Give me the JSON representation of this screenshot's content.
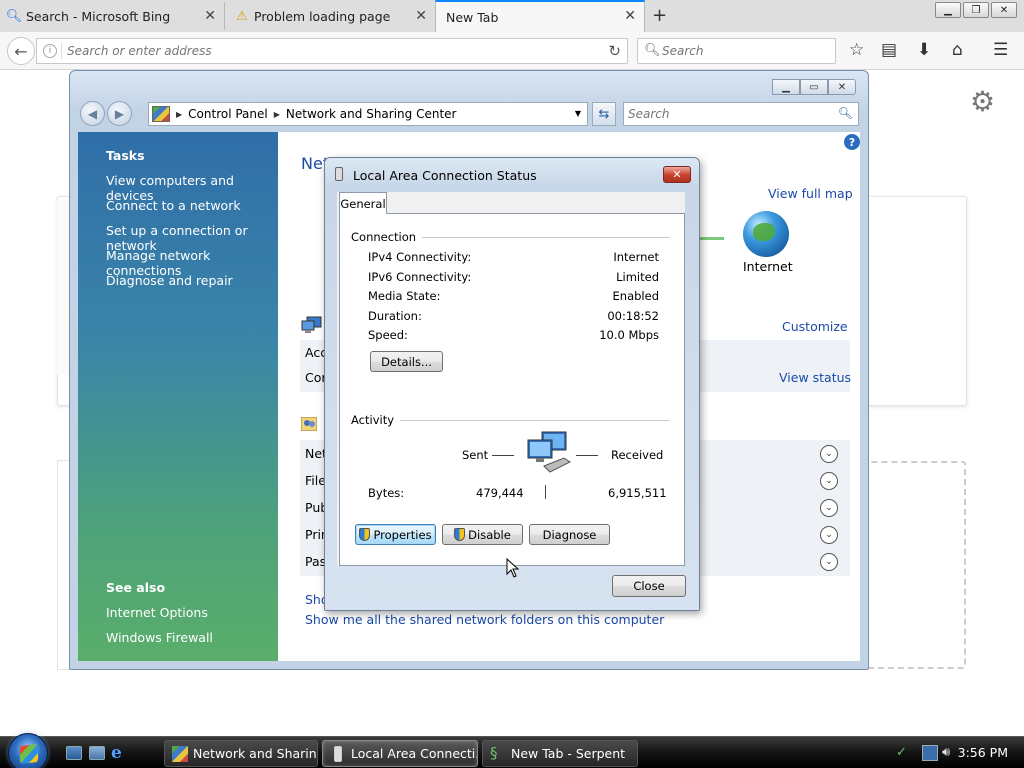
{
  "browser": {
    "tabs": [
      {
        "label": "Search - Microsoft Bing",
        "icon": "search-icon"
      },
      {
        "label": "Problem loading page",
        "icon": "warning-icon"
      },
      {
        "label": "New Tab",
        "icon": ""
      }
    ],
    "address_placeholder": "Search or enter address",
    "search_placeholder": "Search"
  },
  "control_panel": {
    "breadcrumb": [
      "Control Panel",
      "Network and Sharing Center"
    ],
    "search_placeholder": "Search",
    "sidebar": {
      "tasks_heading": "Tasks",
      "tasks": [
        "View computers and devices",
        "Connect to a network",
        "Set up a connection or network",
        "Manage network connections",
        "Diagnose and repair"
      ],
      "see_also_heading": "See also",
      "see_also": [
        "Internet Options",
        "Windows Firewall"
      ]
    },
    "main": {
      "title_fragment": "Net",
      "view_full_map": "View full map",
      "internet_label": "Internet",
      "customize": "Customize",
      "access_fragment": "Acc",
      "connection_fragment": "Cor",
      "view_status": "View status",
      "sharing_rows": [
        "Net",
        "File",
        "Pub",
        "Prin",
        "Pas"
      ],
      "show_fragment": "Sho",
      "show_shared_folders": "Show me all the shared network folders on this computer"
    }
  },
  "dialog": {
    "title": "Local Area Connection Status",
    "tab": "General",
    "connection_group": "Connection",
    "connection": [
      {
        "label": "IPv4 Connectivity:",
        "value": "Internet"
      },
      {
        "label": "IPv6 Connectivity:",
        "value": "Limited"
      },
      {
        "label": "Media State:",
        "value": "Enabled"
      },
      {
        "label": "Duration:",
        "value": "00:18:52"
      },
      {
        "label": "Speed:",
        "value": "10.0 Mbps"
      }
    ],
    "details_button": "Details...",
    "activity_group": "Activity",
    "sent_label": "Sent",
    "received_label": "Received",
    "bytes_label": "Bytes:",
    "bytes_sent": "479,444",
    "bytes_received": "6,915,511",
    "properties_button": "Properties",
    "disable_button": "Disable",
    "diagnose_button": "Diagnose",
    "close_button": "Close"
  },
  "taskbar": {
    "buttons": [
      "Network and Sharin...",
      "Local Area Connecti...",
      "New Tab - Serpent"
    ],
    "clock": "3:56 PM"
  }
}
